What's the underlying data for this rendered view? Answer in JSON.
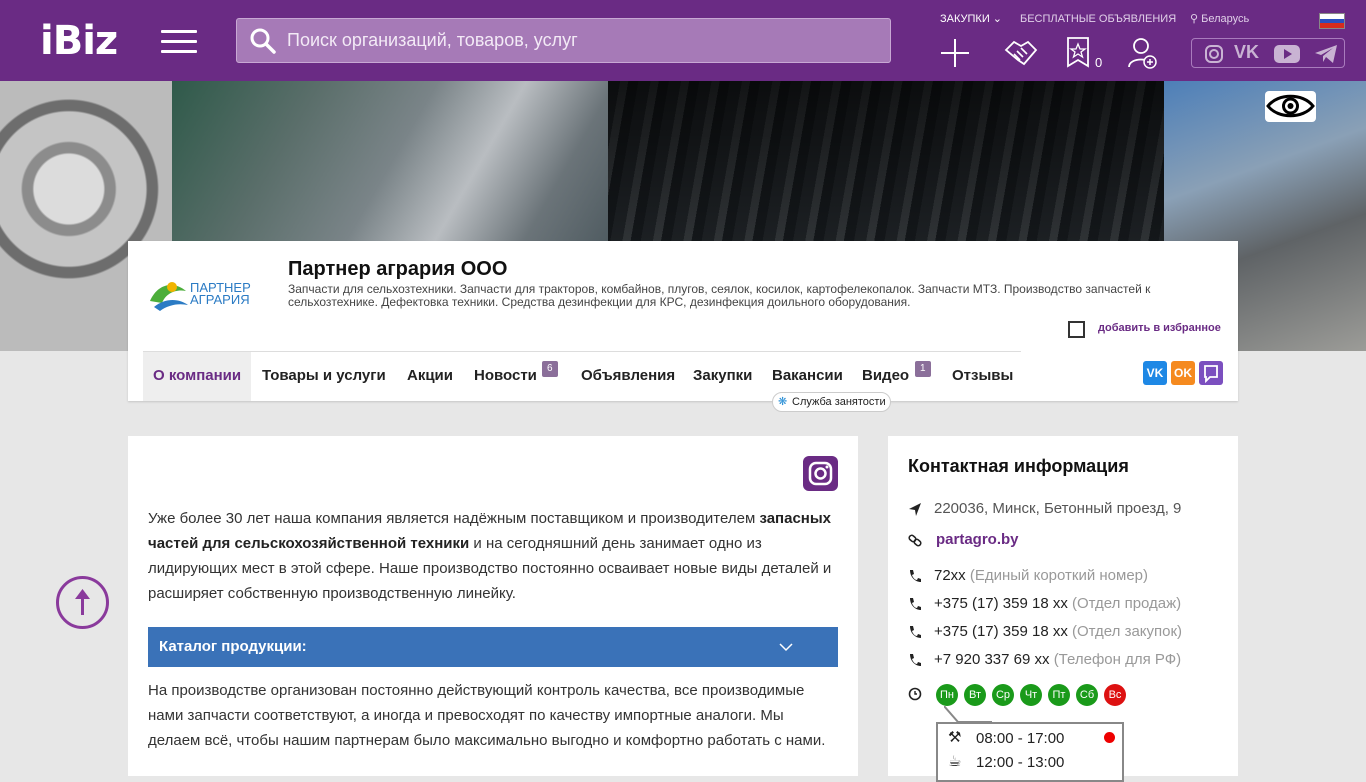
{
  "header": {
    "logo": "iBiz",
    "search_placeholder": "Поиск организаций, товаров, услуг",
    "nav": {
      "purchases": "ЗАКУПКИ",
      "free_ads": "БЕСПЛАТНЫЕ ОБЪЯВЛЕНИЯ",
      "region": "Беларусь"
    },
    "favorites_count": "0",
    "colors": {
      "brand": "#6a2b84"
    }
  },
  "company": {
    "name": "Партнер агрария ООО",
    "logo_text_line1": "ПАРТНЕР",
    "logo_text_line2": "АГРАРИЯ",
    "description": "Запчасти для сельхозтехники. Запчасти для тракторов, комбайнов, плугов, сеялок, косилок, картофелекопалок. Запчасти МТЗ. Производство запчастей к сельхозтехнике. Дефектовка техники. Средства дезинфекции для КРС, дезинфекция доильного оборудования.",
    "add_favorite_label": "добавить в избранное"
  },
  "tabs": [
    {
      "label": "О компании"
    },
    {
      "label": "Товары и услуги"
    },
    {
      "label": "Акции"
    },
    {
      "label": "Новости",
      "badge": "6"
    },
    {
      "label": "Объявления"
    },
    {
      "label": "Закупки"
    },
    {
      "label": "Вакансии"
    },
    {
      "label": "Видео",
      "badge": "1"
    },
    {
      "label": "Отзывы"
    }
  ],
  "vacancy_tooltip": "Служба занятости",
  "main": {
    "intro_start": "Уже более 30 лет наша компания является надёжным поставщиком и производителем ",
    "intro_bold": "запасных частей для сельскохозяйственной техники",
    "intro_end": " и на сегодняшний день занимает одно из лидирующих мест в этой сфере. Наше производство постоянно осваивает новые виды деталей и расширяет собственную производственную линейку.",
    "catalog_label": "Каталог продукции:",
    "quality_text": "На производстве организован постоянно действующий контроль качества, все производимые нами запчасти соответствуют, а иногда и превосходят по качеству импортные аналоги. Мы делаем всё, чтобы нашим партнерам было максимально выгодно и комфортно работать с нами."
  },
  "contacts": {
    "title": "Контактная информация",
    "address": "220036, Минск, Бетонный проезд, 9",
    "website": "partagro.by",
    "phones": [
      {
        "number": "72xx",
        "note": "(Единый короткий номер)"
      },
      {
        "number": "+375 (17) 359 18 xx",
        "note": "(Отдел продаж)"
      },
      {
        "number": "+375 (17) 359 18 xx",
        "note": "(Отдел закупок)"
      },
      {
        "number": "+7 920 337 69 xx",
        "note": "(Телефон для РФ)"
      }
    ],
    "days": [
      {
        "label": "Пн",
        "color": "#1a9a1a"
      },
      {
        "label": "Вт",
        "color": "#1a9a1a"
      },
      {
        "label": "Ср",
        "color": "#1a9a1a"
      },
      {
        "label": "Чт",
        "color": "#1a9a1a"
      },
      {
        "label": "Пт",
        "color": "#1a9a1a"
      },
      {
        "label": "Сб",
        "color": "#1a9a1a"
      },
      {
        "label": "Вс",
        "color": "#dd1111"
      }
    ],
    "work_hours": "08:00 - 17:00",
    "lunch_hours": "12:00 - 13:00"
  }
}
